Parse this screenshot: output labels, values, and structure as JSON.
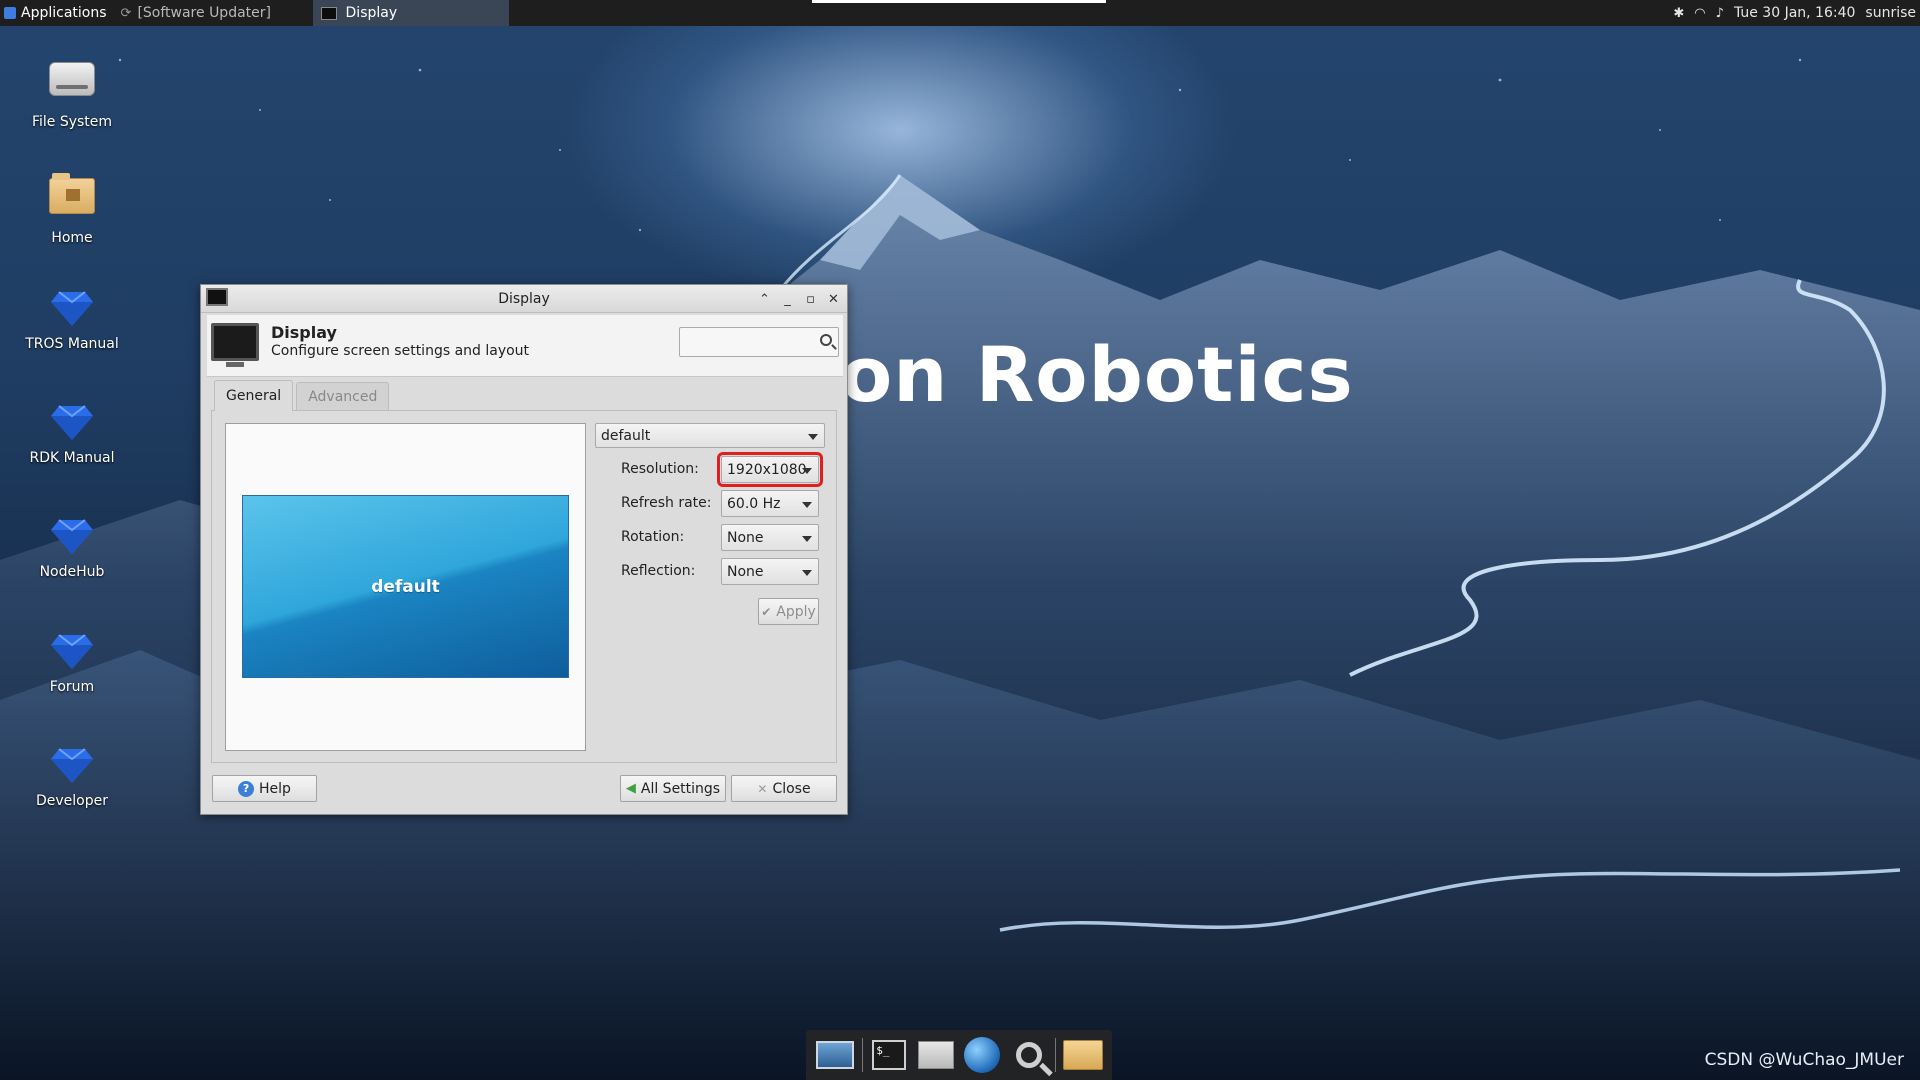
{
  "top_panel": {
    "applications_label": "Applications",
    "tasks": [
      {
        "label": "[Software Updater]"
      },
      {
        "label": "Display"
      }
    ],
    "clock": "Tue 30 Jan, 16:40",
    "user": "sunrise",
    "icons": [
      "bluetooth-icon",
      "wifi-icon",
      "notification-bell-icon"
    ]
  },
  "desktop": {
    "icons": [
      {
        "label": "File System",
        "icon": "drive-icon"
      },
      {
        "label": "Home",
        "icon": "home-folder-icon"
      },
      {
        "label": "TROS Manual",
        "icon": "gem-icon"
      },
      {
        "label": "RDK Manual",
        "icon": "gem-icon"
      },
      {
        "label": "NodeHub",
        "icon": "gem-icon"
      },
      {
        "label": "Forum",
        "icon": "gem-icon"
      },
      {
        "label": "Developer",
        "icon": "gem-icon"
      }
    ],
    "wallpaper_text": "on Robotics",
    "watermark": "CSDN @WuChao_JMUer"
  },
  "dialog": {
    "window_title": "Display",
    "header_title": "Display",
    "header_subtitle": "Configure screen settings and layout",
    "search": {
      "value": "",
      "placeholder": ""
    },
    "tabs": [
      {
        "label": "General",
        "active": true
      },
      {
        "label": "Advanced",
        "active": false
      }
    ],
    "preview_label": "default",
    "output_select": "default",
    "settings": {
      "resolution": {
        "label": "Resolution:",
        "value": "1920x1080"
      },
      "refresh_rate": {
        "label": "Refresh rate:",
        "value": "60.0 Hz"
      },
      "rotation": {
        "label": "Rotation:",
        "value": "None"
      },
      "reflection": {
        "label": "Reflection:",
        "value": "None"
      }
    },
    "buttons": {
      "apply": "Apply",
      "help": "Help",
      "all_settings": "All Settings",
      "close": "Close"
    }
  },
  "dock": {
    "items": [
      "show-desktop-icon",
      "terminal-icon",
      "home-folder-icon",
      "web-browser-icon",
      "search-icon",
      "files-folder-icon"
    ]
  },
  "colors": {
    "highlight": "#e02020",
    "accent": "#2fa6da"
  }
}
